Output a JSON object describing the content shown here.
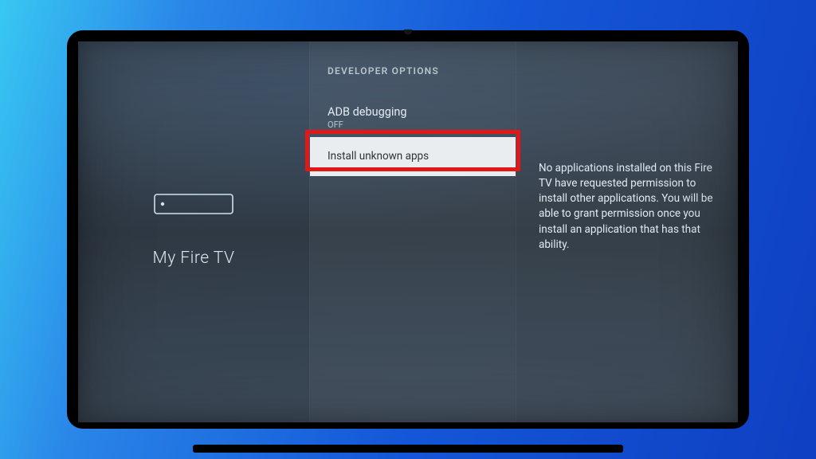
{
  "sidebar": {
    "section_label": "My Fire TV",
    "icon_name": "firetv-stick-icon"
  },
  "menu": {
    "header": "DEVELOPER OPTIONS",
    "items": [
      {
        "title": "ADB debugging",
        "value": "OFF",
        "selected": false
      },
      {
        "title": "Install unknown apps",
        "value": "",
        "selected": true
      }
    ]
  },
  "detail": {
    "description": "No applications installed on this Fire TV have requested permission to install other applications. You will be able to grant permission once you install an application that has that ability."
  },
  "annotation": {
    "highlight_color": "#e11818"
  }
}
